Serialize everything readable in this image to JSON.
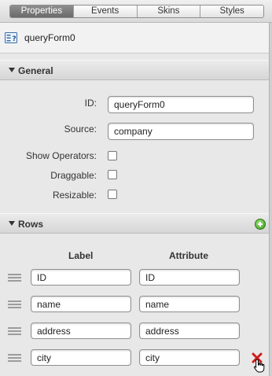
{
  "tabs": [
    {
      "label": "Properties",
      "active": true
    },
    {
      "label": "Events",
      "active": false
    },
    {
      "label": "Skins",
      "active": false
    },
    {
      "label": "Styles",
      "active": false
    }
  ],
  "object": {
    "name": "queryForm0",
    "icon": "query-form-icon"
  },
  "general": {
    "title": "General",
    "id_label": "ID:",
    "id_value": "queryForm0",
    "source_label": "Source:",
    "source_value": "company",
    "show_operators_label": "Show Operators:",
    "show_operators_checked": false,
    "draggable_label": "Draggable:",
    "draggable_checked": false,
    "resizable_label": "Resizable:",
    "resizable_checked": false
  },
  "rows": {
    "title": "Rows",
    "add_icon": "add-icon",
    "col_label": "Label",
    "col_attribute": "Attribute",
    "items": [
      {
        "label": "ID",
        "attribute": "ID"
      },
      {
        "label": "name",
        "attribute": "name"
      },
      {
        "label": "address",
        "attribute": "address"
      },
      {
        "label": "city",
        "attribute": "city"
      }
    ],
    "delete_icon": "delete-icon"
  },
  "colors": {
    "active_tab": "#7a7a7a",
    "add_green": "#3c9b1f",
    "delete_red": "#d11a1a"
  }
}
